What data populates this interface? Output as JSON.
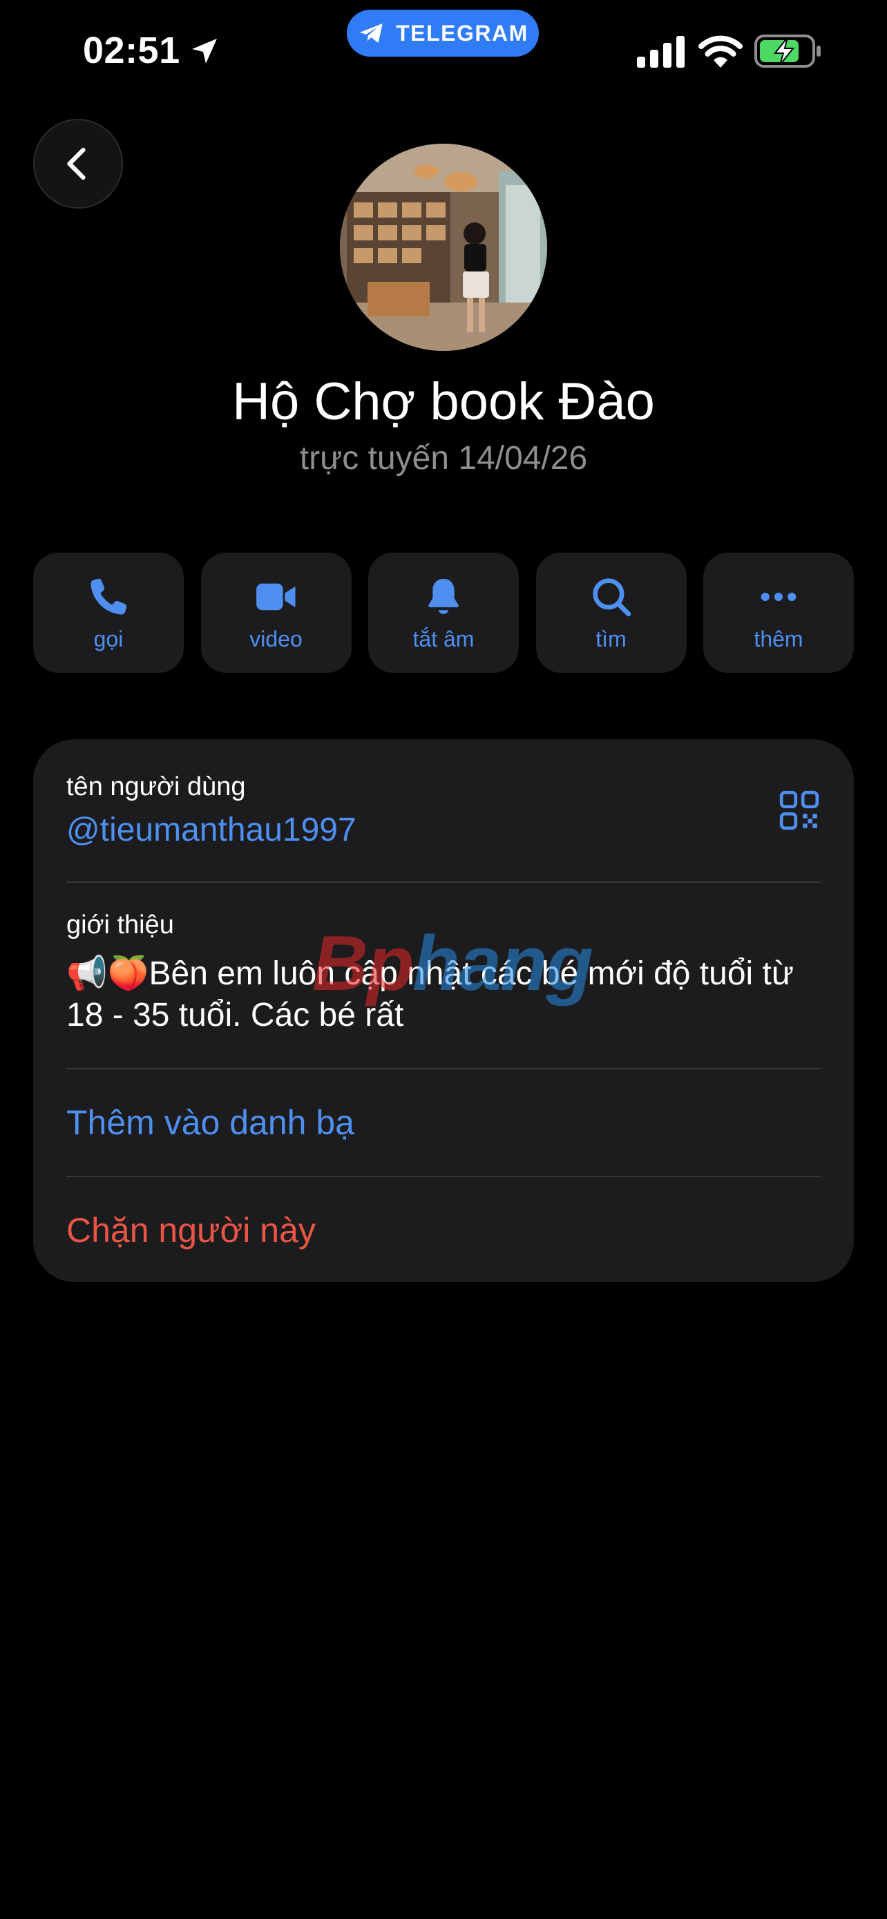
{
  "status_bar": {
    "time": "02:51",
    "pill_label": "TELEGRAM",
    "icons": [
      "location-arrow-icon",
      "telegram-icon",
      "signal-icon",
      "wifi-icon",
      "battery-charging-icon"
    ]
  },
  "header": {
    "back_icon": "chevron-left-icon"
  },
  "profile": {
    "name": "Hộ Chợ book Đào",
    "status": "trực tuyến 14/04/26"
  },
  "actions": [
    {
      "label": "gọi",
      "icon": "phone-icon"
    },
    {
      "label": "video",
      "icon": "video-camera-icon"
    },
    {
      "label": "tắt âm",
      "icon": "bell-icon"
    },
    {
      "label": "tìm",
      "icon": "search-icon"
    },
    {
      "label": "thêm",
      "icon": "more-dots-icon"
    }
  ],
  "info": {
    "username_label": "tên người dùng",
    "username": "@tieumanthau1997",
    "bio_label": "giới thiệu",
    "bio": "📢🍑Bên em luôn cập nhật các bé mới độ tuổi từ 18 - 35 tuổi. Các bé rất",
    "add_contact": "Thêm vào danh bạ",
    "block": "Chặn người này"
  },
  "watermark": {
    "part1": "Bp",
    "part2": "hang"
  },
  "colors": {
    "accent": "#4e8ff0",
    "destructive": "#eb5545",
    "card": "#1c1c1e",
    "telegram_pill": "#2f7cf6"
  }
}
